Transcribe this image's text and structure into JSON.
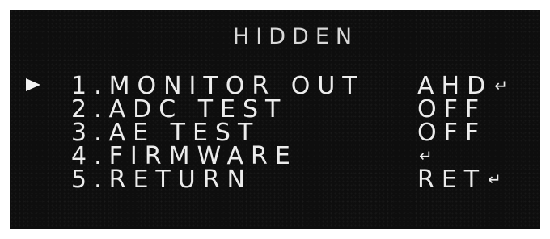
{
  "menu": {
    "title": "HIDDEN",
    "cursor_icon": "right-triangle-icon",
    "items": [
      {
        "label": "1.MONITOR OUT",
        "value": "AHD",
        "enter": "↵"
      },
      {
        "label": "2.ADC TEST",
        "value": "OFF",
        "enter": ""
      },
      {
        "label": "3.AE TEST",
        "value": "OFF",
        "enter": ""
      },
      {
        "label": "4.FIRMWARE",
        "value": "",
        "enter": "↵"
      },
      {
        "label": "5.RETURN",
        "value": "RET",
        "enter": "↵"
      }
    ]
  }
}
